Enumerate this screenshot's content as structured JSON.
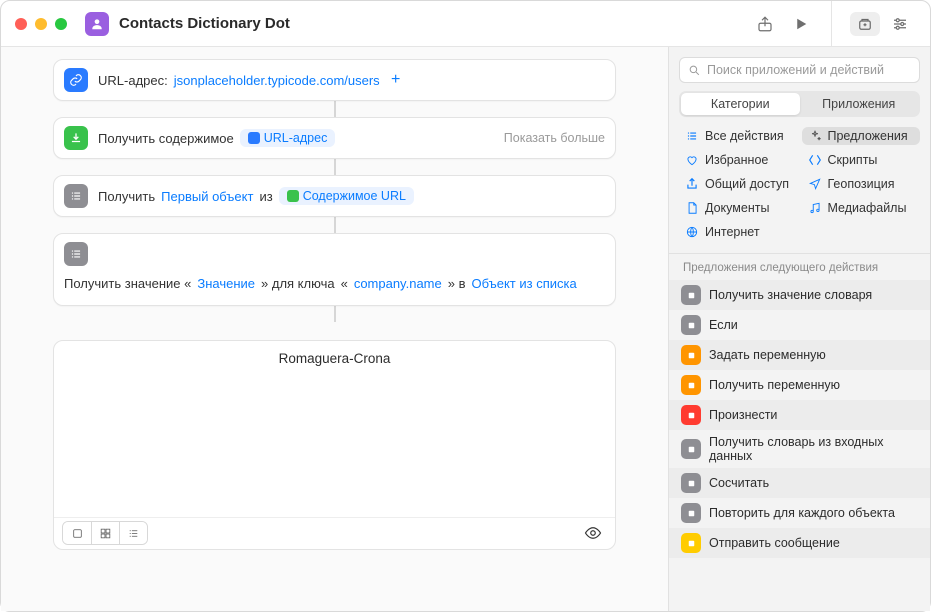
{
  "title": "Contacts Dictionary Dot",
  "search_placeholder": "Поиск приложений и действий",
  "tabs": {
    "categories": "Категории",
    "apps": "Приложения"
  },
  "actions": {
    "url": {
      "label": "URL-адрес:",
      "value": "jsonplaceholder.typicode.com/users"
    },
    "get_contents": {
      "label": "Получить содержимое",
      "param": "URL-адрес",
      "more": "Показать больше"
    },
    "get_item": {
      "label": "Получить",
      "selector": "Первый объект",
      "from": "из",
      "source": "Содержимое URL"
    },
    "get_dict": {
      "label": "Получить значение «",
      "value_token": "Значение",
      "for_key": "» для ключа",
      "key": "company.name",
      "in": "» в",
      "target": "Объект из списка",
      "open_q": "«"
    }
  },
  "result": "Romaguera-Crona",
  "categories": [
    {
      "label": "Все действия",
      "icon": "list",
      "color": "#0a7cff"
    },
    {
      "label": "Предложения",
      "icon": "sparkle",
      "color": "#555",
      "selected": true
    },
    {
      "label": "Избранное",
      "icon": "heart",
      "color": "#0a7cff"
    },
    {
      "label": "Скрипты",
      "icon": "script",
      "color": "#0a7cff"
    },
    {
      "label": "Общий доступ",
      "icon": "share",
      "color": "#0a7cff"
    },
    {
      "label": "Геопозиция",
      "icon": "location",
      "color": "#0a7cff"
    },
    {
      "label": "Документы",
      "icon": "doc",
      "color": "#0a7cff"
    },
    {
      "label": "Медиафайлы",
      "icon": "media",
      "color": "#0a7cff"
    },
    {
      "label": "Интернет",
      "icon": "globe",
      "color": "#0a7cff"
    }
  ],
  "suggestions_header": "Предложения следующего действия",
  "suggestions": [
    {
      "label": "Получить значение словаря",
      "color": "sc-gray"
    },
    {
      "label": "Если",
      "color": "sc-gray"
    },
    {
      "label": "Задать переменную",
      "color": "sc-orange"
    },
    {
      "label": "Получить переменную",
      "color": "sc-orange"
    },
    {
      "label": "Произнести",
      "color": "sc-red"
    },
    {
      "label": "Получить словарь из входных данных",
      "color": "sc-gray"
    },
    {
      "label": "Сосчитать",
      "color": "sc-gray"
    },
    {
      "label": "Повторить для каждого объекта",
      "color": "sc-gray"
    },
    {
      "label": "Отправить сообщение",
      "color": "sc-yellow"
    }
  ]
}
